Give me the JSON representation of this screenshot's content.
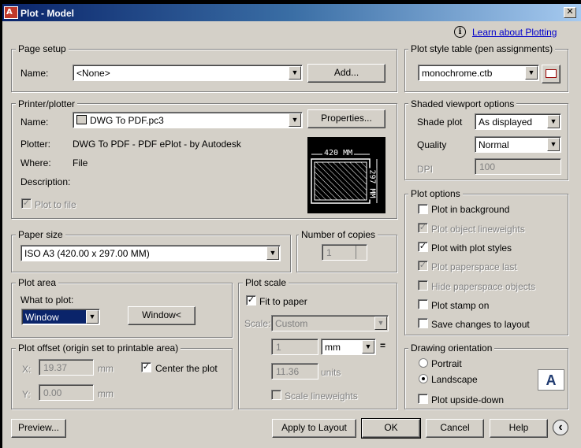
{
  "window": {
    "title": "Plot - Model",
    "icon_text": "A",
    "close_glyph": "✕"
  },
  "help": {
    "info_glyph": "i",
    "link": "Learn about Plotting"
  },
  "page_setup": {
    "label": "Page setup",
    "name_label": "Name:",
    "name_value": "<None>",
    "add_button": "Add..."
  },
  "printer": {
    "label": "Printer/plotter",
    "name_label": "Name:",
    "name_value": "DWG To PDF.pc3",
    "properties_button": "Properties...",
    "plotter_label": "Plotter:",
    "plotter_value": "DWG To PDF - PDF ePlot - by Autodesk",
    "where_label": "Where:",
    "where_value": "File",
    "description_label": "Description:",
    "plot_to_file_label": "Plot to file",
    "preview_width": "420 MM",
    "preview_height": "297 MM"
  },
  "paper_size": {
    "label": "Paper size",
    "value": "ISO A3 (420.00 x 297.00 MM)"
  },
  "copies": {
    "label": "Number of copies",
    "value": "1"
  },
  "plot_area": {
    "label": "Plot area",
    "what_label": "What to plot:",
    "what_value": "Window",
    "window_button": "Window<"
  },
  "plot_offset": {
    "label": "Plot offset (origin set to printable area)",
    "x_label": "X:",
    "x_value": "19.37",
    "x_unit": "mm",
    "y_label": "Y:",
    "y_value": "0.00",
    "y_unit": "mm",
    "center_label": "Center the plot"
  },
  "plot_scale": {
    "label": "Plot scale",
    "fit_label": "Fit to paper",
    "scale_label": "Scale:",
    "scale_value": "Custom",
    "value1": "1",
    "unit1": "mm",
    "equals": "=",
    "value2": "11.36",
    "unit2": "units",
    "scale_lineweights_label": "Scale lineweights"
  },
  "plot_style": {
    "label": "Plot style table (pen assignments)",
    "value": "monochrome.ctb"
  },
  "shaded": {
    "label": "Shaded viewport options",
    "shade_label": "Shade plot",
    "shade_value": "As displayed",
    "quality_label": "Quality",
    "quality_value": "Normal",
    "dpi_label": "DPI",
    "dpi_value": "100"
  },
  "plot_options": {
    "label": "Plot options",
    "items": [
      "Plot in background",
      "Plot object lineweights",
      "Plot with plot styles",
      "Plot paperspace last",
      "Hide paperspace objects",
      "Plot stamp on",
      "Save changes to layout"
    ]
  },
  "orientation": {
    "label": "Drawing orientation",
    "portrait": "Portrait",
    "landscape": "Landscape",
    "upside_down": "Plot upside-down",
    "icon_letter": "A"
  },
  "footer": {
    "preview": "Preview...",
    "apply": "Apply to Layout",
    "ok": "OK",
    "cancel": "Cancel",
    "help": "Help",
    "more_glyph": "‹"
  },
  "check_glyph": "✓",
  "arrow_glyph": "▼"
}
